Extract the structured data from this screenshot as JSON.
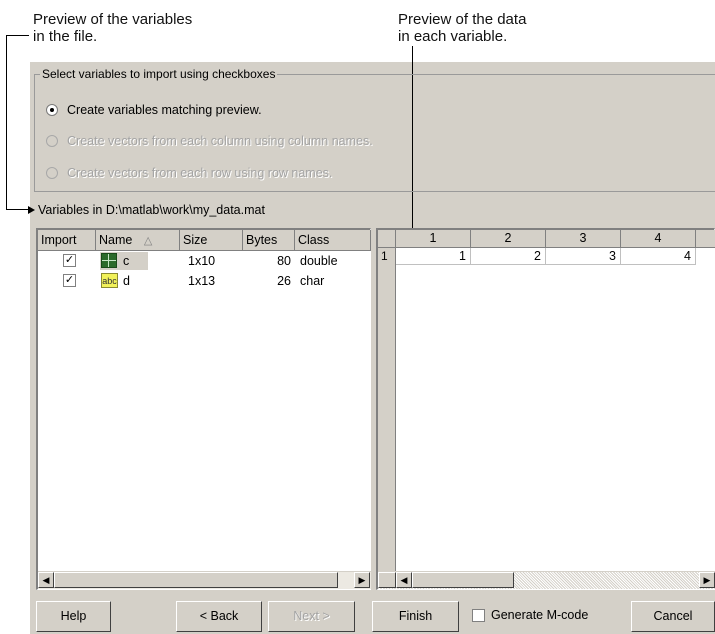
{
  "annotations": {
    "left_line1": "Preview of the variables",
    "left_line2": "in the file.",
    "right_line1": "Preview of the data",
    "right_line2": "in each variable."
  },
  "options_group": {
    "title": "Select variables to import using checkboxes",
    "options": [
      {
        "label": "Create variables matching preview.",
        "selected": true,
        "enabled": true
      },
      {
        "label": "Create vectors from each column using column names.",
        "selected": false,
        "enabled": false
      },
      {
        "label": "Create vectors from each row using row names.",
        "selected": false,
        "enabled": false
      }
    ]
  },
  "variables_label": "Variables in D:\\matlab\\work\\my_data.mat",
  "variables_table": {
    "columns": [
      "Import",
      "Name",
      "Size",
      "Bytes",
      "Class"
    ],
    "sort_indicator": "△",
    "rows": [
      {
        "checked": true,
        "icon": "matrix-icon",
        "name": "c",
        "size": "1x10",
        "bytes": "80",
        "class": "double"
      },
      {
        "checked": true,
        "icon": "string-icon",
        "icon_text": "abc",
        "name": "d",
        "size": "1x13",
        "bytes": "26",
        "class": "char"
      }
    ]
  },
  "data_preview": {
    "col_headers": [
      "1",
      "2",
      "3",
      "4"
    ],
    "row_header": "1",
    "values": [
      "1",
      "2",
      "3",
      "4"
    ]
  },
  "buttons": {
    "help": "Help",
    "back": "< Back",
    "next": "Next >",
    "finish": "Finish",
    "generate": "Generate M-code",
    "cancel": "Cancel"
  },
  "generate_checked": false,
  "colors": {
    "dialog_bg": "#d4d0c8",
    "matrix_icon": "#2c6b2c",
    "string_icon": "#f2f25a"
  }
}
